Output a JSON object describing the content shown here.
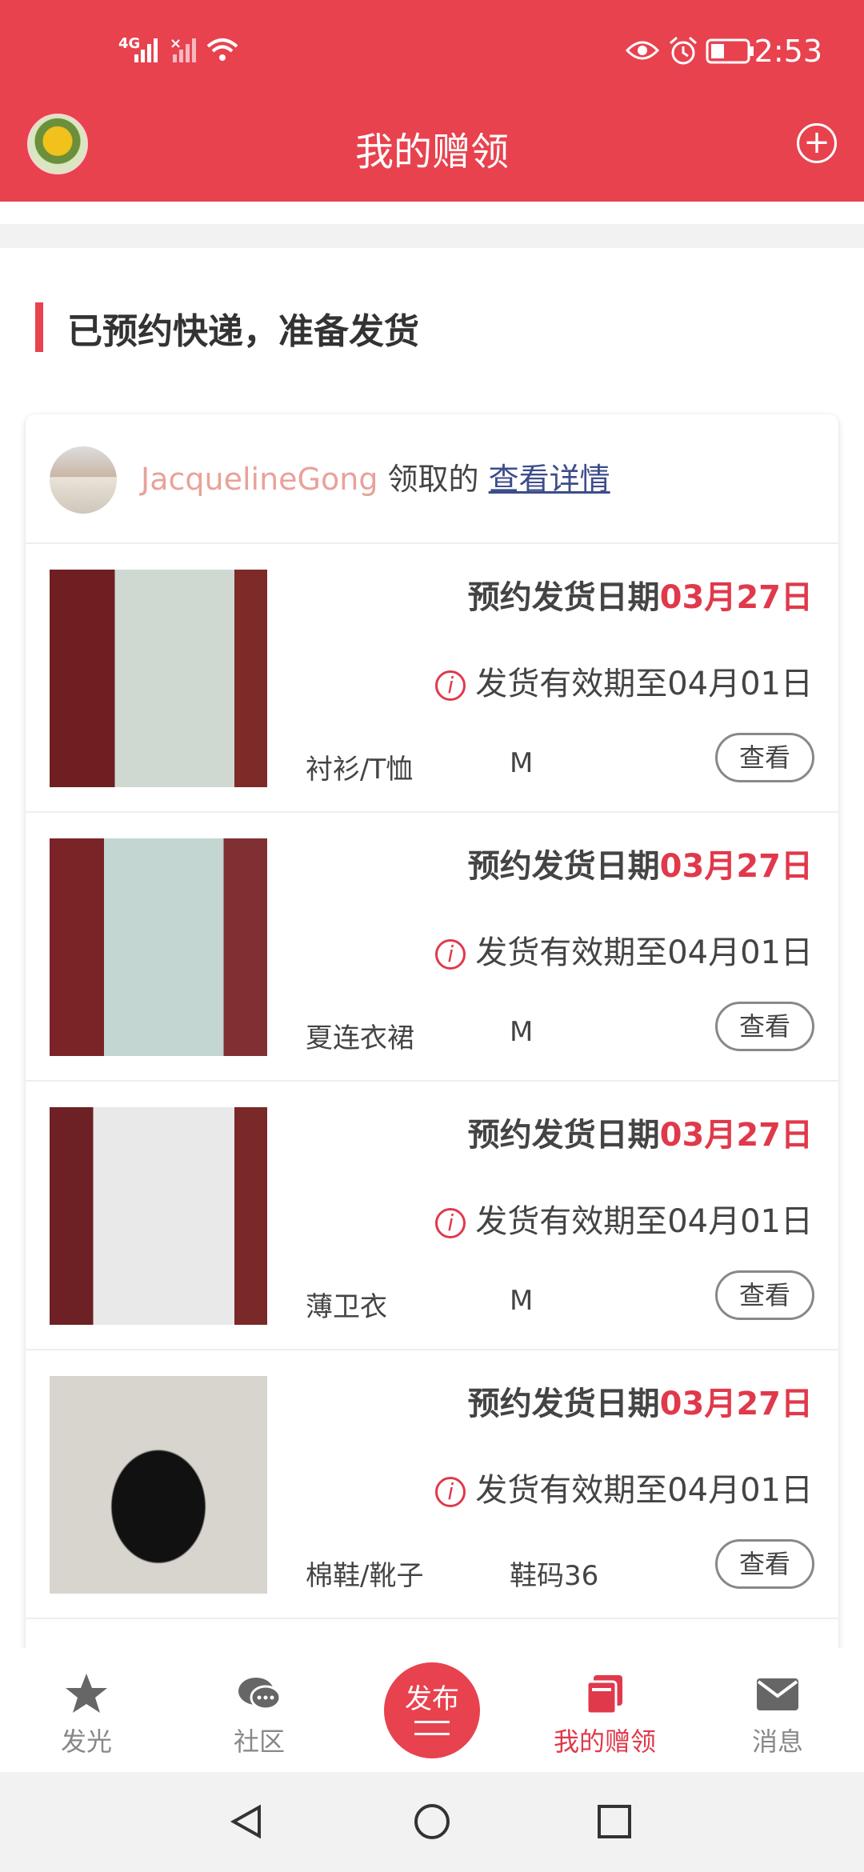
{
  "status_bar": {
    "network_1": "4G",
    "network_2": "×",
    "time": "2:53"
  },
  "header": {
    "title": "我的赠领",
    "plus_icon": "+"
  },
  "section": {
    "title": "已预约快递，准备发货"
  },
  "recipient": {
    "name": "JacquelineGong",
    "action": " 领取的 ",
    "link": "查看详情"
  },
  "items": [
    {
      "ship_label": "预约发货日期",
      "ship_date": "03月27日",
      "info_mark": "i",
      "valid_text": "发货有效期至04月01日",
      "category": "衬衫/T恤",
      "size": "M",
      "view_label": "查看"
    },
    {
      "ship_label": "预约发货日期",
      "ship_date": "03月27日",
      "info_mark": "i",
      "valid_text": "发货有效期至04月01日",
      "category": "夏连衣裙",
      "size": "M",
      "view_label": "查看"
    },
    {
      "ship_label": "预约发货日期",
      "ship_date": "03月27日",
      "info_mark": "i",
      "valid_text": "发货有效期至04月01日",
      "category": "薄卫衣",
      "size": "M",
      "view_label": "查看"
    },
    {
      "ship_label": "预约发货日期",
      "ship_date": "03月27日",
      "info_mark": "i",
      "valid_text": "发货有效期至04月01日",
      "category": "棉鞋/靴子",
      "size": "鞋码36",
      "view_label": "查看"
    }
  ],
  "nav": {
    "shine": "发光",
    "community": "社区",
    "publish": "发布",
    "my_gifts": "我的赠领",
    "messages": "消息"
  },
  "colors": {
    "brand_red": "#e8424f",
    "accent_red": "#e0394b"
  }
}
